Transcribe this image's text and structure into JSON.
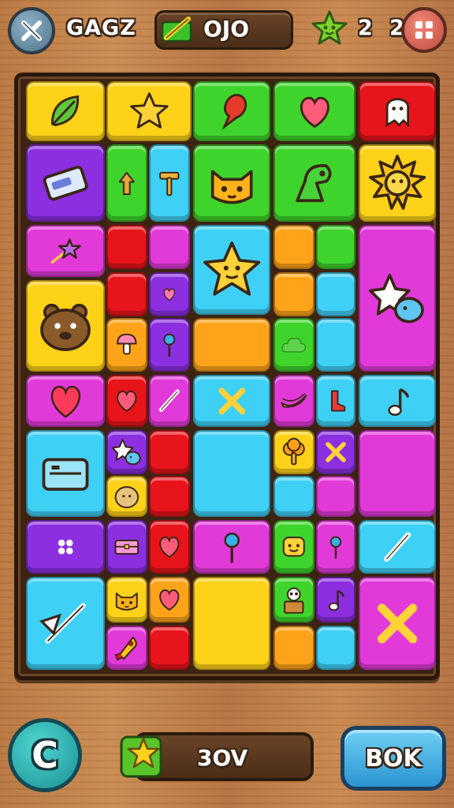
{
  "header": {
    "title": "GAGZ",
    "score": "OJO",
    "star_count": "2 2",
    "close_icon": "close-x-icon",
    "menu_icon": "grid-menu-icon"
  },
  "colors": {
    "yellow": "#ffd21a",
    "green": "#3fd42b",
    "red": "#e8141c",
    "purple": "#8b2fe0",
    "magenta": "#e23ad9",
    "cyan": "#3fd0f5",
    "orange": "#ffa41a",
    "wood": "#c0824a"
  },
  "board": {
    "tiles": [
      {
        "color": "yellow",
        "icon": "leaf-icon"
      },
      {
        "color": "yellow",
        "icon": "star-icon"
      },
      {
        "color": "green",
        "icon": "balloon-icon"
      },
      {
        "color": "green",
        "icon": "heart-icon"
      },
      {
        "color": "red",
        "icon": "ghost-icon"
      },
      {
        "color": "purple",
        "icon": "ticket-icon"
      },
      {
        "color": "green",
        "icon": "arrow-icon"
      },
      {
        "color": "cyan",
        "icon": "hammer-icon"
      },
      {
        "color": "green",
        "icon": "cat-icon"
      },
      {
        "color": "green",
        "icon": "dino-icon"
      },
      {
        "color": "yellow",
        "icon": "sun-icon"
      },
      {
        "color": "magenta",
        "icon": "shooting-star-icon"
      },
      {
        "color": "red",
        "icon": ""
      },
      {
        "color": "magenta",
        "icon": ""
      },
      {
        "color": "cyan",
        "icon": "star-face-icon"
      },
      {
        "color": "orange",
        "icon": ""
      },
      {
        "color": "green",
        "icon": ""
      },
      {
        "color": "magenta",
        "icon": "star-fish-icon"
      },
      {
        "color": "red",
        "icon": ""
      },
      {
        "color": "purple",
        "icon": "small-heart-icon"
      },
      {
        "color": "orange",
        "icon": ""
      },
      {
        "color": "cyan",
        "icon": ""
      },
      {
        "color": "yellow",
        "icon": "bear-icon"
      },
      {
        "color": "orange",
        "icon": "mushroom-icon"
      },
      {
        "color": "purple",
        "icon": "pin-icon"
      },
      {
        "color": "orange",
        "icon": ""
      },
      {
        "color": "green",
        "icon": "cloud-icon"
      },
      {
        "color": "cyan",
        "icon": ""
      },
      {
        "color": "magenta",
        "icon": "big-heart-icon"
      },
      {
        "color": "red",
        "icon": "heart-icon"
      },
      {
        "color": "magenta",
        "icon": "stick-icon"
      },
      {
        "color": "cyan",
        "icon": "x-icon"
      },
      {
        "color": "magenta",
        "icon": "banana-icon"
      },
      {
        "color": "cyan",
        "icon": "boot-icon"
      },
      {
        "color": "cyan",
        "icon": "music-note-icon"
      },
      {
        "color": "cyan",
        "icon": "radio-icon"
      },
      {
        "color": "purple",
        "icon": "star-fish-icon"
      },
      {
        "color": "red",
        "icon": ""
      },
      {
        "color": "cyan",
        "icon": ""
      },
      {
        "color": "yellow",
        "icon": "tree-icon"
      },
      {
        "color": "purple",
        "icon": "x-icon"
      },
      {
        "color": "magenta",
        "icon": ""
      },
      {
        "color": "yellow",
        "icon": "potato-icon"
      },
      {
        "color": "red",
        "icon": ""
      },
      {
        "color": "cyan",
        "icon": ""
      },
      {
        "color": "magenta",
        "icon": ""
      },
      {
        "color": "purple",
        "icon": "sparkle-icon"
      },
      {
        "color": "purple",
        "icon": "chest-icon"
      },
      {
        "color": "red",
        "icon": "heart-icon"
      },
      {
        "color": "magenta",
        "icon": "pin-icon"
      },
      {
        "color": "green",
        "icon": "smiley-icon"
      },
      {
        "color": "magenta",
        "icon": "pin-icon"
      },
      {
        "color": "cyan",
        "icon": "stick-icon"
      },
      {
        "color": "cyan",
        "icon": "sword-icon"
      },
      {
        "color": "yellow",
        "icon": "cat-icon"
      },
      {
        "color": "orange",
        "icon": "heart-icon"
      },
      {
        "color": "yellow",
        "icon": ""
      },
      {
        "color": "green",
        "icon": "panda-box-icon"
      },
      {
        "color": "purple",
        "icon": "music-note-icon"
      },
      {
        "color": "magenta",
        "icon": "x-icon"
      },
      {
        "color": "magenta",
        "icon": "rocket-icon"
      },
      {
        "color": "red",
        "icon": ""
      },
      {
        "color": "orange",
        "icon": ""
      },
      {
        "color": "cyan",
        "icon": ""
      },
      {
        "color": "cyan",
        "icon": "small-heart-icon"
      }
    ]
  },
  "footer": {
    "coin_label": "C",
    "value": "3OV",
    "ok_label": "BOK",
    "star_icon": "star-icon"
  }
}
